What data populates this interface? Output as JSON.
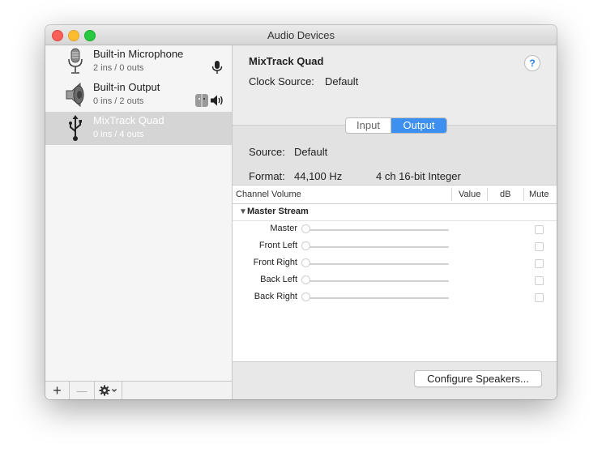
{
  "window": {
    "title": "Audio Devices"
  },
  "sidebar": {
    "devices": [
      {
        "name": "Built-in Microphone",
        "io": "2 ins / 0 outs",
        "icon": "microphone-icon",
        "selected": false
      },
      {
        "name": "Built-in Output",
        "io": "0 ins / 2 outs",
        "icon": "speaker-icon",
        "selected": false
      },
      {
        "name": "MixTrack Quad",
        "io": "0 ins / 4 outs",
        "icon": "usb-icon",
        "selected": true
      }
    ],
    "add_label": "+",
    "remove_label": "—"
  },
  "main": {
    "device_title": "MixTrack Quad",
    "help_label": "?",
    "clock_source_label": "Clock Source:",
    "clock_source_value": "Default",
    "tabs": [
      {
        "label": "Input",
        "active": false
      },
      {
        "label": "Output",
        "active": true
      }
    ],
    "source_label": "Source:",
    "source_value": "Default",
    "format_label": "Format:",
    "format_rate": "44,100 Hz",
    "format_type": "4 ch 16-bit Integer"
  },
  "table": {
    "headers": {
      "channel_volume": "Channel Volume",
      "value": "Value",
      "db": "dB",
      "mute": "Mute"
    },
    "group": "Master Stream",
    "channels": [
      {
        "name": "Master",
        "level": 0
      },
      {
        "name": "Front Left",
        "level": 0
      },
      {
        "name": "Front Right",
        "level": 0
      },
      {
        "name": "Back Left",
        "level": 0
      },
      {
        "name": "Back Right",
        "level": 0
      }
    ]
  },
  "footer": {
    "configure_label": "Configure Speakers..."
  },
  "colors": {
    "accent": "#3d90ef",
    "selection": "#d5d5d5"
  }
}
